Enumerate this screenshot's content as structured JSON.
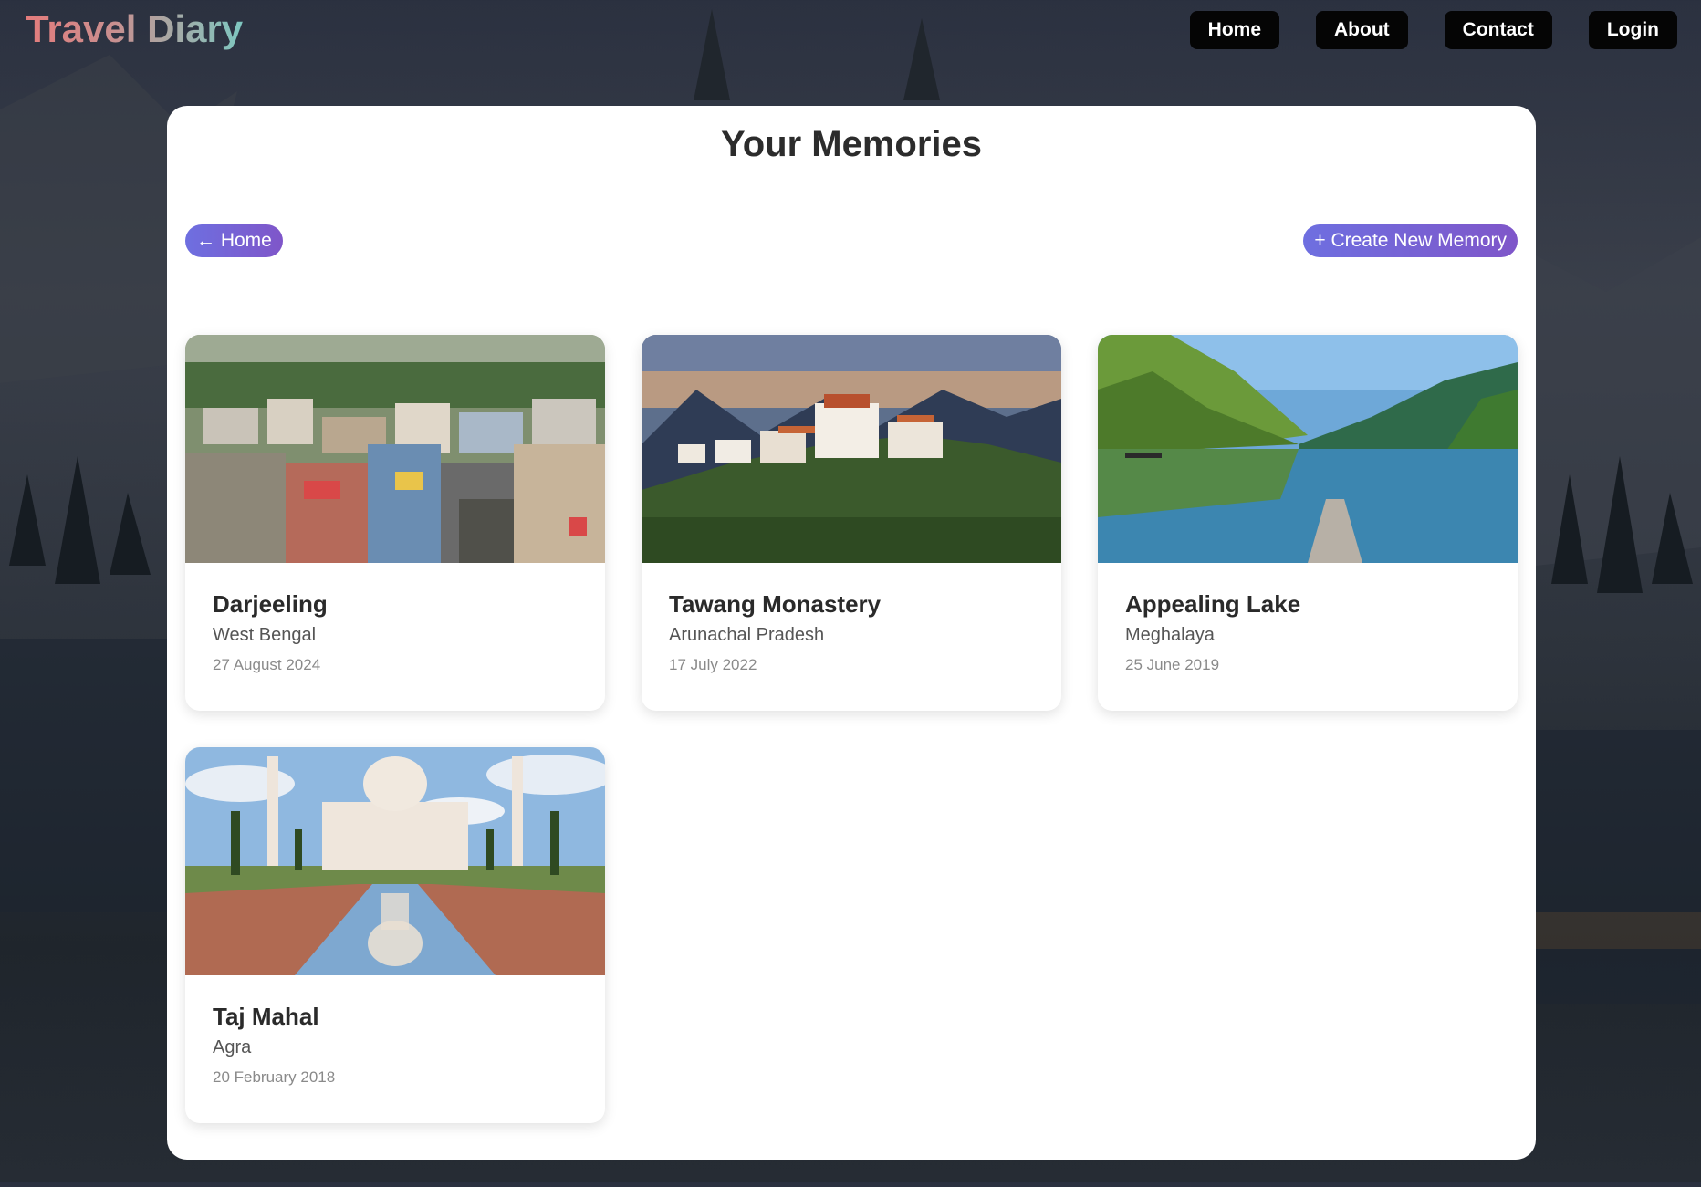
{
  "header": {
    "logo": "Travel Diary",
    "nav": [
      {
        "label": "Home"
      },
      {
        "label": "About"
      },
      {
        "label": "Contact"
      },
      {
        "label": "Login"
      }
    ]
  },
  "main": {
    "title": "Your Memories",
    "back_label": "← Home",
    "create_label": "+ Create New Memory",
    "memories": [
      {
        "title": "Darjeeling",
        "location": "West Bengal",
        "date": "27 August 2024"
      },
      {
        "title": "Tawang Monastery",
        "location": "Arunachal Pradesh",
        "date": "17 July 2022"
      },
      {
        "title": "Appealing Lake",
        "location": "Meghalaya",
        "date": "25 June 2019"
      },
      {
        "title": "Taj Mahal",
        "location": "Agra",
        "date": "20 February 2018"
      }
    ]
  },
  "colors": {
    "accent_start": "#6e6fe0",
    "accent_end": "#7f56c9",
    "nav_bg": "#050505",
    "panel_bg": "#ffffff"
  }
}
